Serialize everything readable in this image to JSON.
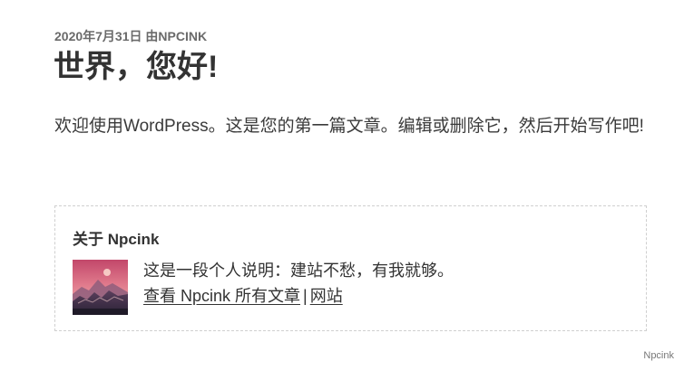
{
  "post": {
    "date": "2020年7月31日",
    "by": "由",
    "author": "NPCINK",
    "title": "世界，您好!",
    "content": "欢迎使用WordPress。这是您的第一篇文章。编辑或删除它，然后开始写作吧!"
  },
  "author_box": {
    "heading": "关于 Npcink",
    "bio": "这是一段个人说明：建站不愁，有我就够。",
    "view_posts_link": "查看 Npcink 所有文章",
    "separator": "|",
    "website_link": "网站"
  },
  "footer": {
    "credit": "Npcink"
  }
}
